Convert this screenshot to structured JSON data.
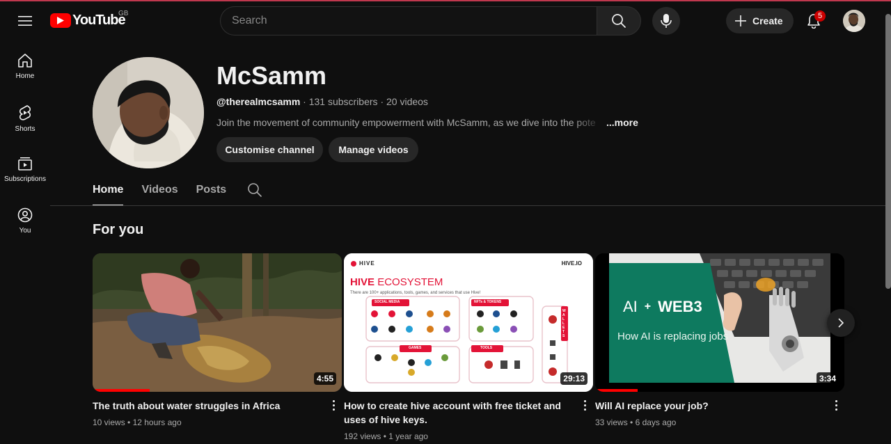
{
  "header": {
    "logo_text": "YouTube",
    "country_code": "GB",
    "search_placeholder": "Search",
    "create_label": "Create",
    "notification_count": "5"
  },
  "sidebar": {
    "items": [
      {
        "label": "Home",
        "icon": "home-icon"
      },
      {
        "label": "Shorts",
        "icon": "shorts-icon"
      },
      {
        "label": "Subscriptions",
        "icon": "subscriptions-icon"
      },
      {
        "label": "You",
        "icon": "you-icon"
      }
    ]
  },
  "channel": {
    "name": "McSamm",
    "handle": "@therealmcsamm",
    "subscribers": "131 subscribers",
    "videos": "20 videos",
    "description": "Join the movement of community empowerment with McSamm, as we dive into the pote",
    "more_label": "...more",
    "customise_label": "Customise channel",
    "manage_label": "Manage videos"
  },
  "tabs": [
    {
      "label": "Home",
      "active": true
    },
    {
      "label": "Videos",
      "active": false
    },
    {
      "label": "Posts",
      "active": false
    }
  ],
  "section_title": "For you",
  "videos": [
    {
      "title": "The truth about water struggles in Africa",
      "views": "10 views",
      "age": "12 hours ago",
      "duration": "4:55",
      "progress": 0.23
    },
    {
      "title": "How to create hive account with free ticket and uses of hive keys.",
      "views": "192 views",
      "age": "1 year ago",
      "duration": "29:13",
      "progress": 0.0,
      "thumb": {
        "brand": "HIVE",
        "site": "HIVE.IO",
        "heading_1": "HIVE",
        "heading_2": "ECOSYSTEM",
        "subheading": "There are 100+ applications, tools, games, and services that use Hive!",
        "box_social": "SOCIAL MEDIA",
        "box_nfts": "NFTs & TOKENS",
        "box_games": "GAMES",
        "box_tools": "TOOLS",
        "box_wallets": "WALLETS"
      }
    },
    {
      "title": "Will AI replace your job?",
      "views": "33 views",
      "age": "6 days ago",
      "duration": "3:34",
      "progress": 0.17,
      "thumb": {
        "ai": "AI",
        "plus": "+",
        "web3": "WEB3",
        "caption": "How AI is replacing jobs"
      }
    }
  ],
  "colors": {
    "background": "#0f0f0f",
    "accent_red": "#ff0000",
    "hive_red": "#e31337",
    "ai_green": "#0e7a5f"
  }
}
